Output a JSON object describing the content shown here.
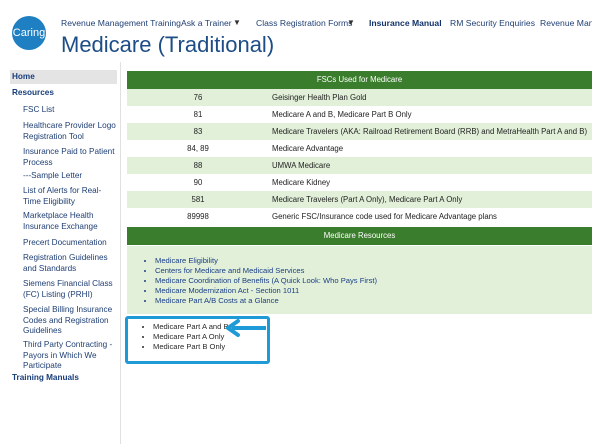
{
  "brand": {
    "logo_text": "Caring"
  },
  "nav": {
    "items": [
      "Revenue Management Training",
      "Ask a Trainer",
      "Class Registration Forms",
      "Insurance Manual",
      "RM Security Enquiries",
      "Revenue Manag"
    ]
  },
  "page": {
    "title": "Medicare (Traditional)"
  },
  "sidebar": {
    "home": "Home",
    "resources": "Resources",
    "items": [
      "FSC List",
      "Healthcare Provider Logo Registration Tool",
      "Insurance Paid to Patient Process",
      "---Sample Letter",
      "List of Alerts for Real-Time Eligibility",
      "Marketplace Health Insurance Exchange",
      "Precert Documentation",
      "Registration Guidelines and Standards",
      "Siemens Financial Class (FC) Listing (PRHI)",
      "Special Billing Insurance Codes and Registration Guidelines",
      "Third Party Contracting - Payors in Which We Participate"
    ],
    "training": "Training Manuals"
  },
  "fsc_table": {
    "header": "FSCs Used for Medicare",
    "rows": [
      {
        "code": "76",
        "desc": "Geisinger Health Plan Gold"
      },
      {
        "code": "81",
        "desc": "Medicare A and B, Medicare Part B Only"
      },
      {
        "code": "83",
        "desc": "Medicare Travelers (AKA:  Railroad Retirement Board (RRB) and MetraHealth Part A and B)"
      },
      {
        "code": "84, 89",
        "desc": "Medicare Advantage"
      },
      {
        "code": "88",
        "desc": "UMWA Medicare"
      },
      {
        "code": "90",
        "desc": "Medicare Kidney"
      },
      {
        "code": "581",
        "desc": "Medicare Travelers (Part A Only), Medicare Part A Only"
      },
      {
        "code": "89998",
        "desc": "Generic FSC/Insurance code used for Medicare Advantage plans"
      }
    ]
  },
  "resources": {
    "header": "Medicare Resources",
    "links": [
      "Medicare Eligibility",
      "Centers for Medicare and Medicaid Services",
      "Medicare Coordination of Benefits (A Quick Look:  Who Pays First)",
      "Medicare Modernization Act - Section 1011",
      "Medicare Part A/B Costs at a Glance"
    ]
  },
  "parts": {
    "items": [
      "Medicare Part A and B",
      "Medicare Part A Only",
      "Medicare Part B Only"
    ]
  },
  "colors": {
    "header_green": "#3a7d2c",
    "row_green": "#e2f0d9",
    "highlight_blue": "#1e9bd7",
    "logo_blue": "#1e7fc2"
  }
}
